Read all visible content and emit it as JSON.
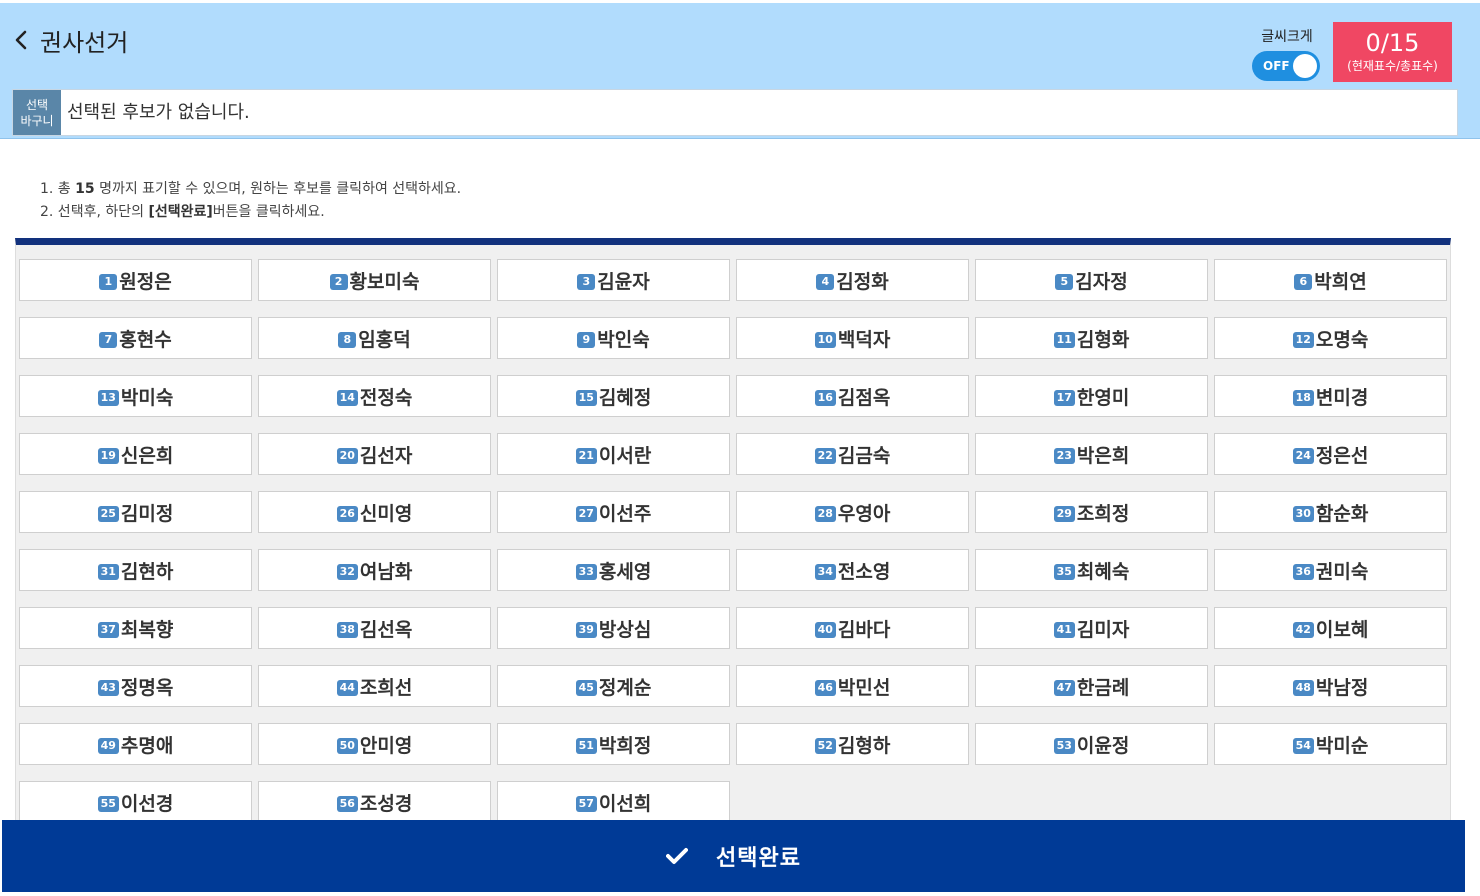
{
  "header": {
    "title": "권사선거",
    "font_toggle_label": "글씨크게",
    "font_toggle_state": "OFF",
    "vote_count": "0/15",
    "vote_count_caption": "(현재표수/총표수)"
  },
  "basket": {
    "tag_line1": "선택",
    "tag_line2": "바구니",
    "message": "선택된 후보가 없습니다."
  },
  "instructions": {
    "line1_pre": "1. 총 ",
    "line1_bold": "15",
    "line1_post": " 명까지 표기할 수 있으며, 원하는 후보를 클릭하여 선택하세요.",
    "line2_pre": "2. 선택후, 하단의 ",
    "line2_bold": "[선택완료]",
    "line2_post": "버튼을 클릭하세요."
  },
  "candidates": [
    {
      "num": "1",
      "name": "원정은"
    },
    {
      "num": "2",
      "name": "황보미숙"
    },
    {
      "num": "3",
      "name": "김윤자"
    },
    {
      "num": "4",
      "name": "김정화"
    },
    {
      "num": "5",
      "name": "김자정"
    },
    {
      "num": "6",
      "name": "박희연"
    },
    {
      "num": "7",
      "name": "홍현수"
    },
    {
      "num": "8",
      "name": "임홍덕"
    },
    {
      "num": "9",
      "name": "박인숙"
    },
    {
      "num": "10",
      "name": "백덕자"
    },
    {
      "num": "11",
      "name": "김형화"
    },
    {
      "num": "12",
      "name": "오명숙"
    },
    {
      "num": "13",
      "name": "박미숙"
    },
    {
      "num": "14",
      "name": "전정숙"
    },
    {
      "num": "15",
      "name": "김혜정"
    },
    {
      "num": "16",
      "name": "김점옥"
    },
    {
      "num": "17",
      "name": "한영미"
    },
    {
      "num": "18",
      "name": "변미경"
    },
    {
      "num": "19",
      "name": "신은희"
    },
    {
      "num": "20",
      "name": "김선자"
    },
    {
      "num": "21",
      "name": "이서란"
    },
    {
      "num": "22",
      "name": "김금숙"
    },
    {
      "num": "23",
      "name": "박은희"
    },
    {
      "num": "24",
      "name": "정은선"
    },
    {
      "num": "25",
      "name": "김미정"
    },
    {
      "num": "26",
      "name": "신미영"
    },
    {
      "num": "27",
      "name": "이선주"
    },
    {
      "num": "28",
      "name": "우영아"
    },
    {
      "num": "29",
      "name": "조희정"
    },
    {
      "num": "30",
      "name": "함순화"
    },
    {
      "num": "31",
      "name": "김현하"
    },
    {
      "num": "32",
      "name": "여남화"
    },
    {
      "num": "33",
      "name": "홍세영"
    },
    {
      "num": "34",
      "name": "전소영"
    },
    {
      "num": "35",
      "name": "최혜숙"
    },
    {
      "num": "36",
      "name": "권미숙"
    },
    {
      "num": "37",
      "name": "최복향"
    },
    {
      "num": "38",
      "name": "김선옥"
    },
    {
      "num": "39",
      "name": "방상심"
    },
    {
      "num": "40",
      "name": "김바다"
    },
    {
      "num": "41",
      "name": "김미자"
    },
    {
      "num": "42",
      "name": "이보혜"
    },
    {
      "num": "43",
      "name": "정명옥"
    },
    {
      "num": "44",
      "name": "조희선"
    },
    {
      "num": "45",
      "name": "정계순"
    },
    {
      "num": "46",
      "name": "박민선"
    },
    {
      "num": "47",
      "name": "한금례"
    },
    {
      "num": "48",
      "name": "박남정"
    },
    {
      "num": "49",
      "name": "추명애"
    },
    {
      "num": "50",
      "name": "안미영"
    },
    {
      "num": "51",
      "name": "박희정"
    },
    {
      "num": "52",
      "name": "김형하"
    },
    {
      "num": "53",
      "name": "이윤정"
    },
    {
      "num": "54",
      "name": "박미순"
    },
    {
      "num": "55",
      "name": "이선경"
    },
    {
      "num": "56",
      "name": "조성경"
    },
    {
      "num": "57",
      "name": "이선희"
    }
  ],
  "submit": {
    "label": "선택완료"
  },
  "colors": {
    "header_bg": "#b1dcfd",
    "vote_count_bg": "#f04763",
    "toggle_bg": "#1f8fe0",
    "panel_top_bar": "#12317d",
    "submit_bg": "#003a96",
    "number_badge": "#4a89c5"
  },
  "icons": {
    "back": "chevron-left-icon",
    "submit": "check-icon"
  }
}
